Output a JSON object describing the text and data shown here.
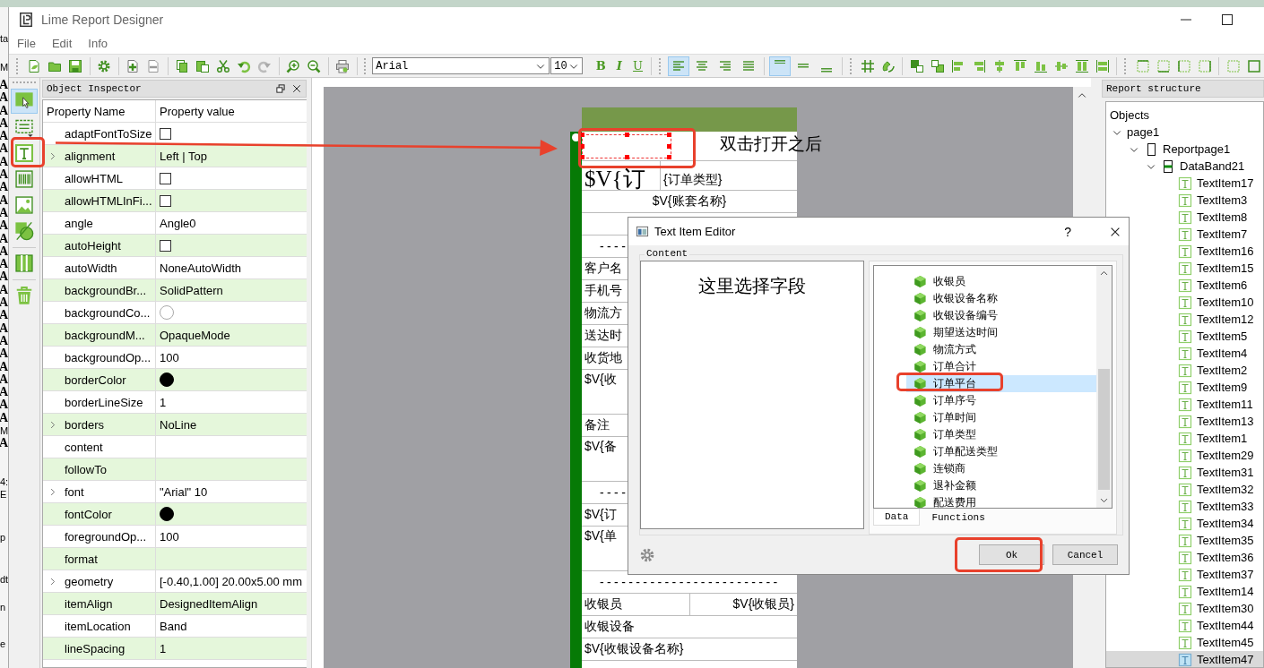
{
  "background_window": {
    "letters": [
      "ta",
      "M",
      "A",
      "A",
      "A",
      "A",
      "A",
      "A",
      "A",
      "A",
      "A",
      "A",
      "A",
      "A",
      "A",
      "A",
      "A",
      "A",
      "A",
      "A",
      "A",
      "A",
      "A",
      "A",
      "A",
      "A",
      "A",
      "A",
      "A",
      "M",
      "A",
      "4:",
      "E",
      "p",
      "dt",
      "n",
      "e"
    ]
  },
  "window": {
    "title": "Lime Report Designer"
  },
  "menu": [
    "File",
    "Edit",
    "Info"
  ],
  "toolbar": {
    "font": "Arial",
    "font_size": "10",
    "style_buttons": [
      "B",
      "I",
      "U"
    ],
    "horizontal_align": [
      {
        "selected": true
      },
      {
        "selected": false
      },
      {
        "selected": false
      },
      {
        "selected": false
      }
    ],
    "vertical_align": [
      {
        "selected": true
      },
      {
        "selected": false
      },
      {
        "selected": false
      }
    ]
  },
  "tool_strip": [
    {
      "selected": true
    },
    {
      "selected": false
    },
    {
      "selected": false
    },
    {
      "selected": false
    },
    {
      "selected": false
    },
    {
      "selected": false
    },
    {
      "selected": false
    },
    {
      "selected": false
    }
  ],
  "object_inspector": {
    "title": "Object Inspector",
    "columns": [
      "Property Name",
      "Property value"
    ],
    "rows": [
      {
        "name": "adaptFontToSize",
        "kind": "checkbox",
        "checked": false,
        "expandable": false
      },
      {
        "name": "alignment",
        "kind": "text",
        "value": "Left | Top",
        "expandable": true
      },
      {
        "name": "allowHTML",
        "kind": "checkbox",
        "checked": false,
        "expandable": false
      },
      {
        "name": "allowHTMLInFi...",
        "kind": "checkbox",
        "checked": false,
        "expandable": false
      },
      {
        "name": "angle",
        "kind": "text",
        "value": "Angle0",
        "expandable": false
      },
      {
        "name": "autoHeight",
        "kind": "checkbox",
        "checked": false,
        "expandable": false
      },
      {
        "name": "autoWidth",
        "kind": "text",
        "value": "NoneAutoWidth",
        "expandable": false
      },
      {
        "name": "backgroundBr...",
        "kind": "text",
        "value": "SolidPattern",
        "expandable": false
      },
      {
        "name": "backgroundCo...",
        "kind": "color",
        "color": "#ffffff",
        "expandable": false
      },
      {
        "name": "backgroundM...",
        "kind": "text",
        "value": "OpaqueMode",
        "expandable": false
      },
      {
        "name": "backgroundOp...",
        "kind": "text",
        "value": "100",
        "expandable": false
      },
      {
        "name": "borderColor",
        "kind": "color",
        "color": "#000000",
        "expandable": false
      },
      {
        "name": "borderLineSize",
        "kind": "text",
        "value": "1",
        "expandable": false
      },
      {
        "name": "borders",
        "kind": "text",
        "value": "NoLine",
        "expandable": true
      },
      {
        "name": "content",
        "kind": "text",
        "expandable": false
      },
      {
        "name": "followTo",
        "kind": "text",
        "expandable": false
      },
      {
        "name": "font",
        "kind": "text",
        "value": "\"Arial\" 10",
        "expandable": true
      },
      {
        "name": "fontColor",
        "kind": "color",
        "color": "#000000",
        "expandable": false
      },
      {
        "name": "foregroundOp...",
        "kind": "text",
        "value": "100",
        "expandable": false
      },
      {
        "name": "format",
        "kind": "text",
        "expandable": false
      },
      {
        "name": "geometry",
        "kind": "text",
        "value": "[-0.40,1.00] 20.00x5.00 mm",
        "expandable": true
      },
      {
        "name": "itemAlign",
        "kind": "text",
        "value": "DesignedItemAlign",
        "expandable": false
      },
      {
        "name": "itemLocation",
        "kind": "text",
        "value": "Band",
        "expandable": false
      },
      {
        "name": "lineSpacing",
        "kind": "text",
        "value": "1",
        "expandable": false
      }
    ]
  },
  "canvas": {
    "annotation": "双击打开之后",
    "report_rows": [
      {
        "kind": "title",
        "cells": [
          {
            "text": "$V{订",
            "kind": "left"
          },
          {
            "text": "{订单类型}",
            "kind": "left"
          }
        ]
      },
      {
        "kind": "line",
        "cells": [
          {
            "text": "$V{账套名称}",
            "kind": "center"
          }
        ]
      },
      {
        "kind": "line"
      },
      {
        "kind": "line",
        "cells": [
          {
            "text": "----",
            "kind": "indent"
          }
        ]
      },
      {
        "kind": "line",
        "cells": [
          {
            "text": "客户名",
            "kind": "left"
          }
        ]
      },
      {
        "kind": "line",
        "cells": [
          {
            "text": "手机号",
            "kind": "left"
          }
        ]
      },
      {
        "kind": "line",
        "cells": [
          {
            "text": "物流方",
            "kind": "left"
          }
        ]
      },
      {
        "kind": "line",
        "cells": [
          {
            "text": "送达时",
            "kind": "left"
          }
        ]
      },
      {
        "kind": "line",
        "cells": [
          {
            "text": "收货地",
            "kind": "left"
          }
        ]
      },
      {
        "kind": "tall",
        "cells": [
          {
            "text": "$V{收",
            "kind": "left"
          }
        ]
      },
      {
        "kind": "line",
        "cells": [
          {
            "text": "备注",
            "kind": "left"
          }
        ]
      },
      {
        "kind": "tall",
        "cells": [
          {
            "text": "$V{备",
            "kind": "left"
          }
        ]
      },
      {
        "kind": "line",
        "cells": [
          {
            "text": "----",
            "kind": "indent"
          }
        ]
      },
      {
        "kind": "line",
        "cells": [
          {
            "text": "$V{订",
            "kind": "left"
          }
        ]
      },
      {
        "kind": "tall",
        "cells": [
          {
            "text": "$V{单",
            "kind": "left"
          }
        ]
      },
      {
        "kind": "line",
        "cells": [
          {
            "text": "-------------------------",
            "kind": "indent"
          }
        ]
      },
      {
        "kind": "line",
        "cells": [
          {
            "text": "收银员",
            "kind": "left"
          },
          {
            "text": "$V{收银员}",
            "kind": "right"
          }
        ]
      },
      {
        "kind": "line",
        "cells": [
          {
            "text": "收银设备",
            "kind": "left"
          }
        ]
      },
      {
        "kind": "line",
        "cells": [
          {
            "text": "$V{收银设备名称}",
            "kind": "left"
          }
        ]
      },
      {
        "kind": "line"
      }
    ]
  },
  "report_structure": {
    "title": "Report structure",
    "root_label": "Objects",
    "tree": [
      {
        "label": "page1",
        "expanded": true,
        "selected": false,
        "children": [
          {
            "label": "Reportpage1",
            "kind": "report_page",
            "expanded": true,
            "selected": false,
            "children": [
              {
                "label": "DataBand21",
                "kind": "band",
                "expanded": true,
                "selected": false,
                "children": [
                  {
                    "label": "TextItem17",
                    "kind": "text_item",
                    "selected": false
                  },
                  {
                    "label": "TextItem3",
                    "kind": "text_item",
                    "selected": false
                  },
                  {
                    "label": "TextItem8",
                    "kind": "text_item",
                    "selected": false
                  },
                  {
                    "label": "TextItem7",
                    "kind": "text_item",
                    "selected": false
                  },
                  {
                    "label": "TextItem16",
                    "kind": "text_item",
                    "selected": false
                  },
                  {
                    "label": "TextItem15",
                    "kind": "text_item",
                    "selected": false
                  },
                  {
                    "label": "TextItem6",
                    "kind": "text_item",
                    "selected": false
                  },
                  {
                    "label": "TextItem10",
                    "kind": "text_item",
                    "selected": false
                  },
                  {
                    "label": "TextItem12",
                    "kind": "text_item",
                    "selected": false
                  },
                  {
                    "label": "TextItem5",
                    "kind": "text_item",
                    "selected": false
                  },
                  {
                    "label": "TextItem4",
                    "kind": "text_item",
                    "selected": false
                  },
                  {
                    "label": "TextItem2",
                    "kind": "text_item",
                    "selected": false
                  },
                  {
                    "label": "TextItem9",
                    "kind": "text_item",
                    "selected": false
                  },
                  {
                    "label": "TextItem11",
                    "kind": "text_item",
                    "selected": false
                  },
                  {
                    "label": "TextItem13",
                    "kind": "text_item",
                    "selected": false
                  },
                  {
                    "label": "TextItem1",
                    "kind": "text_item",
                    "selected": false
                  },
                  {
                    "label": "TextItem29",
                    "kind": "text_item",
                    "selected": false
                  },
                  {
                    "label": "TextItem31",
                    "kind": "text_item",
                    "selected": false
                  },
                  {
                    "label": "TextItem32",
                    "kind": "text_item",
                    "selected": false
                  },
                  {
                    "label": "TextItem33",
                    "kind": "text_item",
                    "selected": false
                  },
                  {
                    "label": "TextItem34",
                    "kind": "text_item",
                    "selected": false
                  },
                  {
                    "label": "TextItem35",
                    "kind": "text_item",
                    "selected": false
                  },
                  {
                    "label": "TextItem36",
                    "kind": "text_item",
                    "selected": false
                  },
                  {
                    "label": "TextItem37",
                    "kind": "text_item",
                    "selected": false
                  },
                  {
                    "label": "TextItem14",
                    "kind": "text_item",
                    "selected": false
                  },
                  {
                    "label": "TextItem30",
                    "kind": "text_item",
                    "selected": false
                  },
                  {
                    "label": "TextItem44",
                    "kind": "text_item",
                    "selected": false
                  },
                  {
                    "label": "TextItem45",
                    "kind": "text_item",
                    "selected": false
                  },
                  {
                    "label": "TextItem47",
                    "kind": "text_item",
                    "selected": true
                  }
                ]
              }
            ]
          }
        ]
      }
    ]
  },
  "dialog": {
    "title": "Text Item Editor",
    "help": "?",
    "group": "Content",
    "content": "这里选择字段",
    "fields": [
      {
        "label": "收银员",
        "selected": false
      },
      {
        "label": "收银设备名称",
        "selected": false
      },
      {
        "label": "收银设备编号",
        "selected": false
      },
      {
        "label": "期望送达时间",
        "selected": false
      },
      {
        "label": "物流方式",
        "selected": false
      },
      {
        "label": "订单合计",
        "selected": false
      },
      {
        "label": "订单平台",
        "selected": true
      },
      {
        "label": "订单序号",
        "selected": false
      },
      {
        "label": "订单时间",
        "selected": false
      },
      {
        "label": "订单类型",
        "selected": false
      },
      {
        "label": "订单配送类型",
        "selected": false
      },
      {
        "label": "连锁商",
        "selected": false
      },
      {
        "label": "退补金额",
        "selected": false
      },
      {
        "label": "配送费用",
        "selected": false
      }
    ],
    "tabs": [
      {
        "label": "Data",
        "selected": true
      },
      {
        "label": "Functions",
        "selected": false
      }
    ],
    "buttons": [
      "Ok",
      "Cancel"
    ]
  }
}
